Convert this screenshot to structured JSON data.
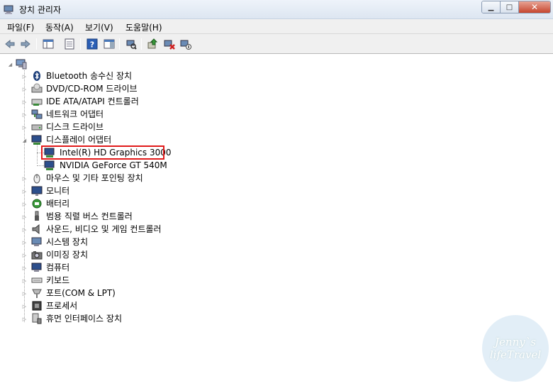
{
  "window": {
    "title": "장치 관리자",
    "minimize": "▁",
    "maximize": "□",
    "close": "✕"
  },
  "menu": {
    "items": [
      "파일(F)",
      "동작(A)",
      "보기(V)",
      "도움말(H)"
    ]
  },
  "toolbar": {
    "icons": [
      "back-icon",
      "forward-icon",
      "show-hide-console-tree-icon",
      "properties-icon",
      "help-icon",
      "show-action-pane-icon",
      "scan-hardware-icon",
      "update-driver-icon",
      "uninstall-icon",
      "disable-icon"
    ]
  },
  "tree": {
    "root_icon": "computer-icon",
    "categories": [
      {
        "label": "Bluetooth 송수신 장치",
        "icon": "bluetooth-icon"
      },
      {
        "label": "DVD/CD-ROM 드라이브",
        "icon": "dvd-drive-icon"
      },
      {
        "label": "IDE ATA/ATAPI 컨트롤러",
        "icon": "ide-controller-icon"
      },
      {
        "label": "네트워크 어댑터",
        "icon": "network-adapter-icon"
      },
      {
        "label": "디스크 드라이브",
        "icon": "disk-drive-icon"
      },
      {
        "label": "디스플레이 어댑터",
        "icon": "display-adapter-icon"
      },
      {
        "label": "Intel(R) HD Graphics 3000",
        "icon": "display-adapter-icon"
      },
      {
        "label": "NVIDIA GeForce GT 540M",
        "icon": "display-adapter-icon"
      },
      {
        "label": "마우스 및 기타 포인팅 장치",
        "icon": "mouse-icon"
      },
      {
        "label": "모니터",
        "icon": "monitor-icon"
      },
      {
        "label": "배터리",
        "icon": "battery-icon"
      },
      {
        "label": "범용 직렬 버스 컨트롤러",
        "icon": "usb-icon"
      },
      {
        "label": "사운드, 비디오 및 게임 컨트롤러",
        "icon": "sound-icon"
      },
      {
        "label": "시스템 장치",
        "icon": "system-device-icon"
      },
      {
        "label": "이미징 장치",
        "icon": "imaging-device-icon"
      },
      {
        "label": "컴퓨터",
        "icon": "computer-icon"
      },
      {
        "label": "키보드",
        "icon": "keyboard-icon"
      },
      {
        "label": "포트(COM & LPT)",
        "icon": "port-icon"
      },
      {
        "label": "프로세서",
        "icon": "processor-icon"
      },
      {
        "label": "휴먼 인터페이스 장치",
        "icon": "hid-icon"
      }
    ],
    "highlight_color": "#e11a1a"
  },
  "watermark": {
    "line1": "Jenny`s",
    "line2": "lifeTravel"
  }
}
